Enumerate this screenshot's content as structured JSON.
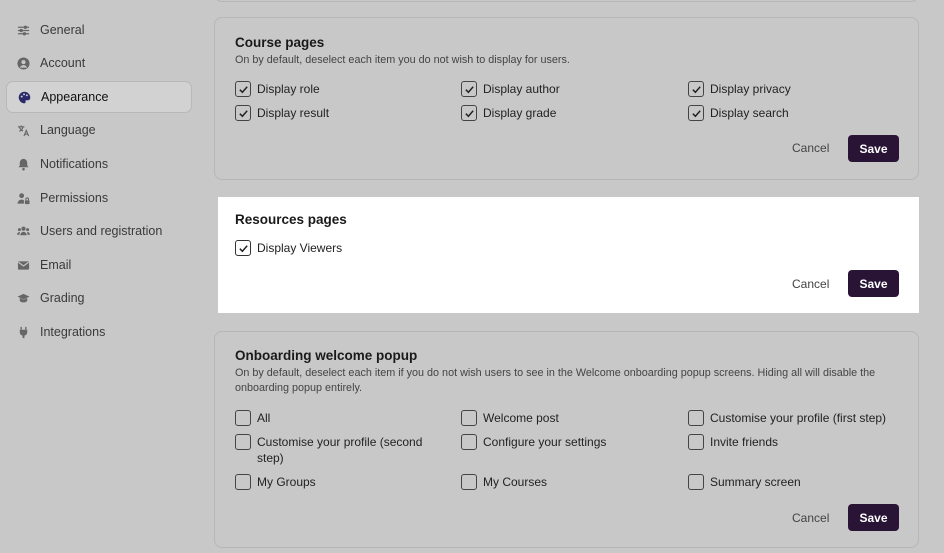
{
  "sidebar": {
    "items": [
      {
        "label": "General",
        "icon": "sliders-icon"
      },
      {
        "label": "Account",
        "icon": "user-icon"
      },
      {
        "label": "Appearance",
        "icon": "palette-icon",
        "active": true
      },
      {
        "label": "Language",
        "icon": "translate-icon"
      },
      {
        "label": "Notifications",
        "icon": "bell-icon"
      },
      {
        "label": "Permissions",
        "icon": "user-lock-icon"
      },
      {
        "label": "Users and registration",
        "icon": "users-icon"
      },
      {
        "label": "Email",
        "icon": "envelope-icon"
      },
      {
        "label": "Grading",
        "icon": "graduation-cap-icon"
      },
      {
        "label": "Integrations",
        "icon": "plug-icon"
      }
    ]
  },
  "course_pages": {
    "title": "Course pages",
    "description": "On by default, deselect each item you do not wish to display for users.",
    "options": [
      {
        "label": "Display role",
        "checked": true
      },
      {
        "label": "Display author",
        "checked": true
      },
      {
        "label": "Display privacy",
        "checked": true
      },
      {
        "label": "Display result",
        "checked": true
      },
      {
        "label": "Display grade",
        "checked": true
      },
      {
        "label": "Display search",
        "checked": true
      }
    ],
    "cancel_label": "Cancel",
    "save_label": "Save"
  },
  "resources_pages": {
    "title": "Resources pages",
    "options": [
      {
        "label": "Display Viewers",
        "checked": true
      }
    ],
    "cancel_label": "Cancel",
    "save_label": "Save"
  },
  "onboarding": {
    "title": "Onboarding welcome popup",
    "description": "On by default, deselect each item if you do not wish users to see in the Welcome onboarding popup screens. Hiding all will disable the onboarding popup entirely.",
    "options": [
      {
        "label": "All",
        "checked": false
      },
      {
        "label": "Welcome post",
        "checked": false
      },
      {
        "label": "Customise your profile (first step)",
        "checked": false
      },
      {
        "label": "Customise your profile (second step)",
        "checked": false
      },
      {
        "label": "Configure your settings",
        "checked": false
      },
      {
        "label": "Invite friends",
        "checked": false
      },
      {
        "label": "My Groups",
        "checked": false
      },
      {
        "label": "My Courses",
        "checked": false
      },
      {
        "label": "Summary screen",
        "checked": false
      }
    ],
    "cancel_label": "Cancel",
    "save_label": "Save"
  },
  "colors": {
    "save_button": "#2a1436",
    "overlay": "#c8c8c8",
    "highlight_panel": "#ffffff"
  }
}
